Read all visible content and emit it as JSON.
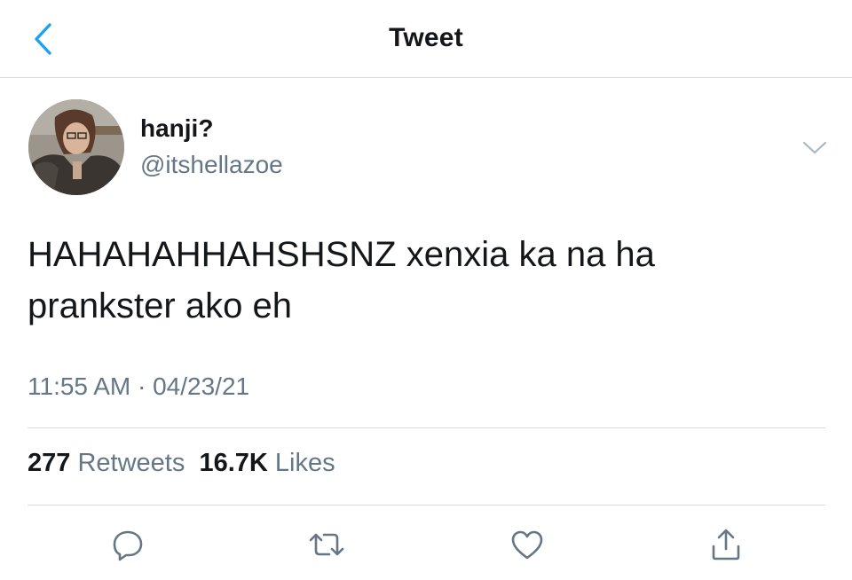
{
  "header": {
    "title": "Tweet",
    "back_icon": "chevron-left-icon",
    "accent_color": "#1da1f2"
  },
  "tweet": {
    "author": {
      "display_name": "hanji?",
      "handle": "@itshellazoe"
    },
    "text_lines": [
      "HAHAHAHHAHSHSNZ xenxia ka na ha",
      "prankster ako eh"
    ],
    "timestamp": "11:55 AM · 04/23/21",
    "stats": {
      "retweets_count": "277",
      "retweets_label": "Retweets",
      "likes_count": "16.7K",
      "likes_label": "Likes"
    },
    "actions": [
      {
        "name": "reply",
        "icon": "reply-icon"
      },
      {
        "name": "retweet",
        "icon": "retweet-icon"
      },
      {
        "name": "like",
        "icon": "heart-icon"
      },
      {
        "name": "share",
        "icon": "share-icon"
      }
    ]
  },
  "colors": {
    "text_primary": "#14171a",
    "text_secondary": "#657786",
    "divider": "#d7dadd",
    "link_blue": "#1da1f2"
  }
}
